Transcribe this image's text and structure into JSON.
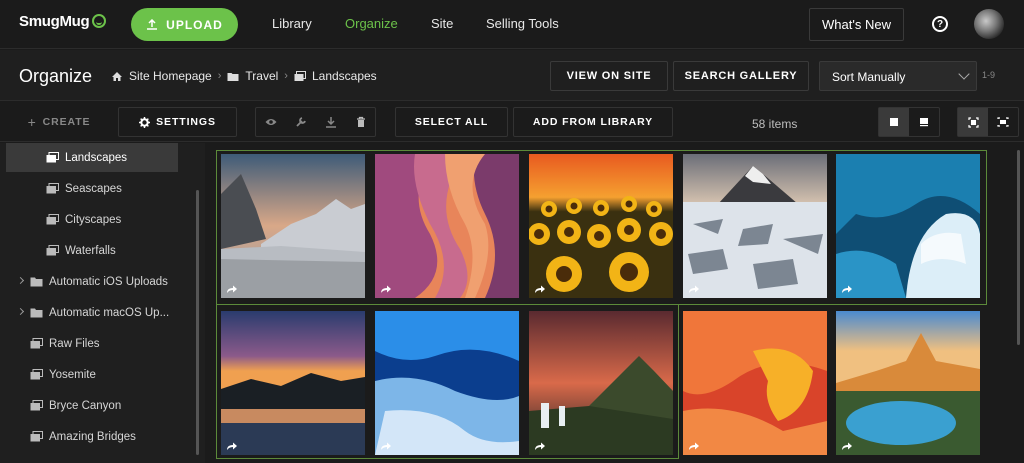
{
  "app": {
    "name": "SmugMug"
  },
  "topnav": {
    "upload_label": "UPLOAD",
    "links": [
      "Library",
      "Organize",
      "Site",
      "Selling Tools"
    ],
    "active_link": "Organize",
    "whats_new_label": "What's New",
    "help_icon": "question-circle-icon",
    "accent_color": "#6cc24a"
  },
  "header": {
    "title": "Organize",
    "breadcrumb": [
      "Site Homepage",
      "Travel",
      "Landscapes"
    ],
    "view_on_site_label": "VIEW ON SITE",
    "search_gallery_label": "SEARCH GALLERY",
    "sort_value": "Sort Manually",
    "range_label": "1-9"
  },
  "toolbar": {
    "create_label": "CREATE",
    "settings_label": "SETTINGS",
    "select_all_label": "SELECT ALL",
    "add_from_library_label": "ADD FROM LIBRARY",
    "item_count": "58 items",
    "icons": [
      "eye-icon",
      "wrench-icon",
      "download-icon",
      "trash-icon"
    ]
  },
  "sidebar": {
    "items": [
      {
        "label": "Landscapes",
        "active": true
      },
      {
        "label": "Seascapes"
      },
      {
        "label": "Cityscapes"
      },
      {
        "label": "Waterfalls"
      },
      {
        "label": "Automatic iOS Uploads",
        "expandable": true
      },
      {
        "label": "Automatic macOS Up...",
        "expandable": true
      },
      {
        "label": "Raw Files"
      },
      {
        "label": "Yosemite"
      },
      {
        "label": "Bryce Canyon"
      },
      {
        "label": "Amazing Bridges"
      }
    ]
  },
  "photos": [
    {
      "subject": "yosemite-valley"
    },
    {
      "subject": "antelope-canyon"
    },
    {
      "subject": "sunflower-field"
    },
    {
      "subject": "kirkjufell-ice"
    },
    {
      "subject": "ice-cave"
    },
    {
      "subject": "lake-sunset"
    },
    {
      "subject": "glacier-river"
    },
    {
      "subject": "kirkjufellsfoss"
    },
    {
      "subject": "lava-flow"
    },
    {
      "subject": "alpine-lake"
    }
  ]
}
